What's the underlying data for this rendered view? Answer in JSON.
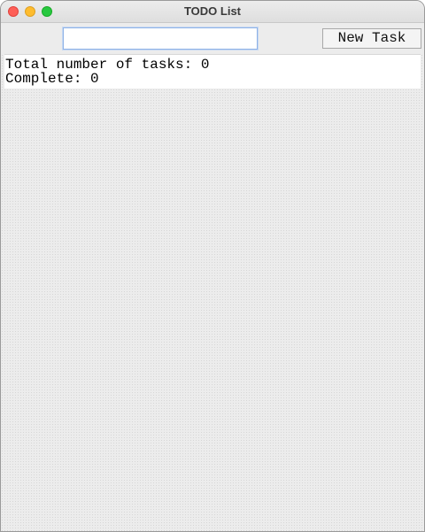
{
  "window": {
    "title": "TODO List"
  },
  "toolbar": {
    "task_input_value": "",
    "new_task_label": "New Task"
  },
  "stats": {
    "total_text": "Total number of tasks: 0",
    "complete_text": "Complete: 0"
  }
}
